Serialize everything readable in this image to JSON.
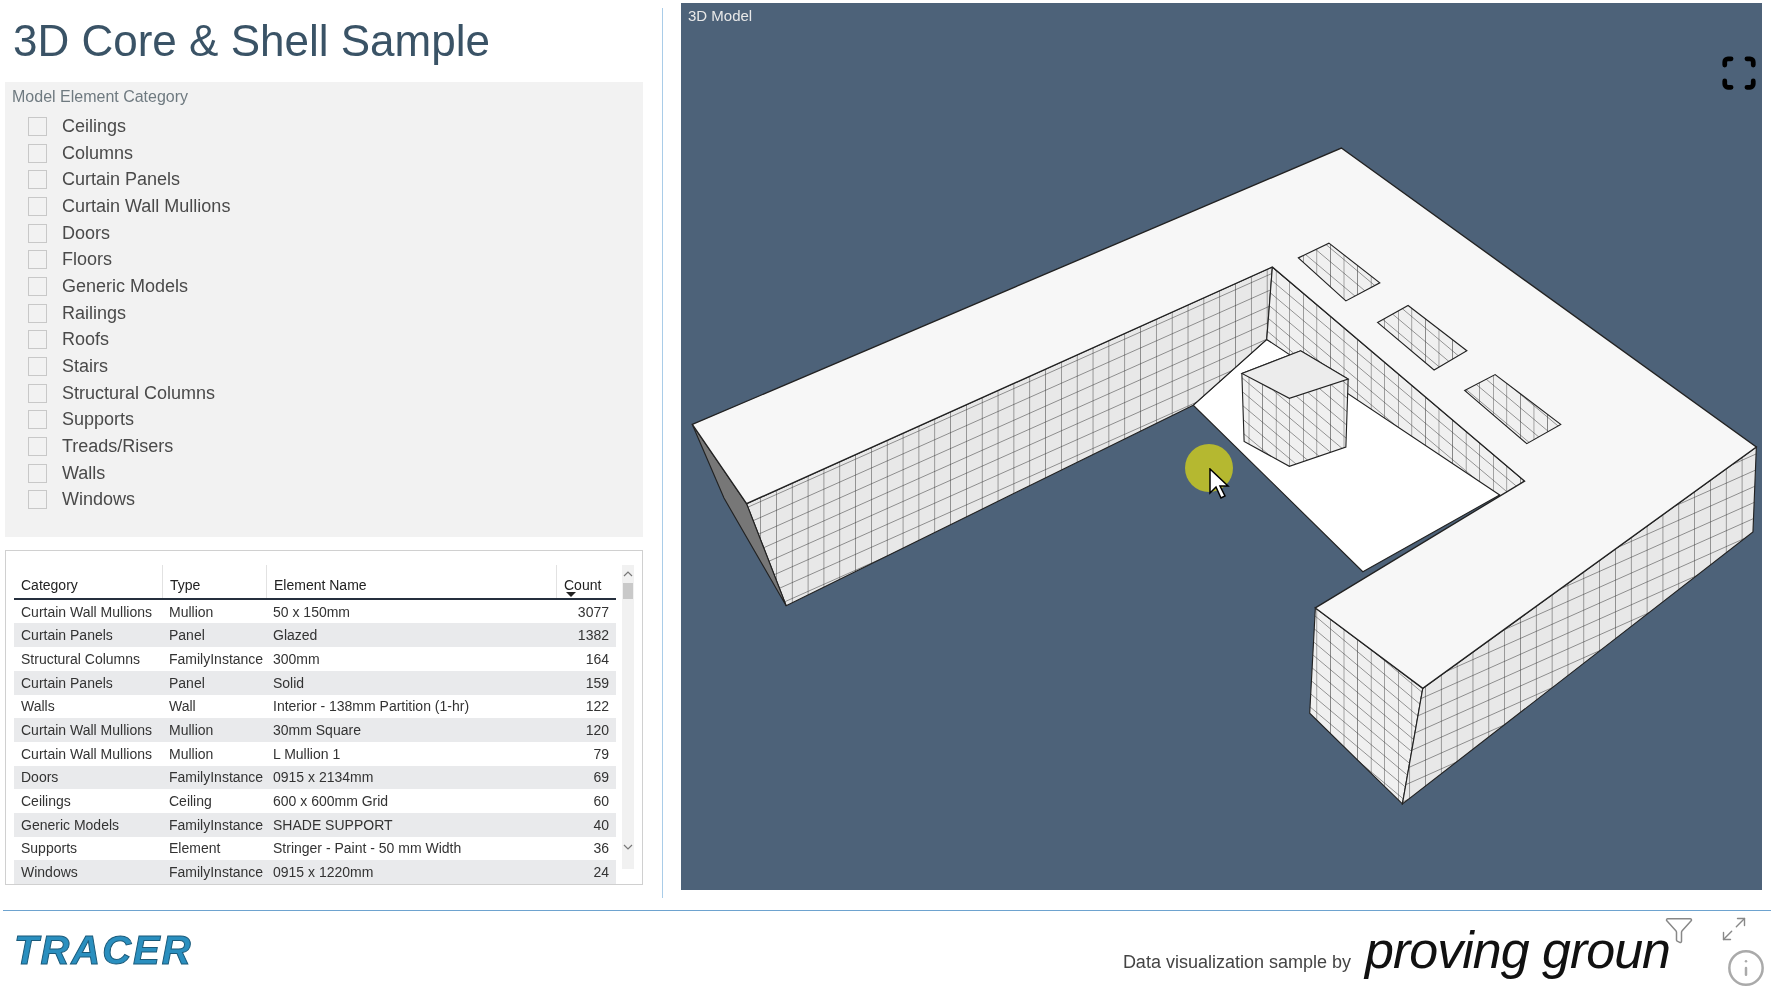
{
  "title": "3D Core & Shell Sample",
  "slicer": {
    "title": "Model Element Category",
    "items": [
      {
        "label": "Ceilings",
        "checked": false
      },
      {
        "label": "Columns",
        "checked": false
      },
      {
        "label": "Curtain Panels",
        "checked": false
      },
      {
        "label": "Curtain Wall Mullions",
        "checked": false
      },
      {
        "label": "Doors",
        "checked": false
      },
      {
        "label": "Floors",
        "checked": false
      },
      {
        "label": "Generic Models",
        "checked": false
      },
      {
        "label": "Railings",
        "checked": false
      },
      {
        "label": "Roofs",
        "checked": false
      },
      {
        "label": "Stairs",
        "checked": false
      },
      {
        "label": "Structural Columns",
        "checked": false
      },
      {
        "label": "Supports",
        "checked": false
      },
      {
        "label": "Treads/Risers",
        "checked": false
      },
      {
        "label": "Walls",
        "checked": false
      },
      {
        "label": "Windows",
        "checked": false
      }
    ]
  },
  "table": {
    "columns": [
      "Category",
      "Type",
      "Element Name",
      "Count"
    ],
    "rows": [
      [
        "Curtain Wall Mullions",
        "Mullion",
        "50 x 150mm",
        "3077"
      ],
      [
        "Curtain Panels",
        "Panel",
        "Glazed",
        "1382"
      ],
      [
        "Structural Columns",
        "FamilyInstance",
        "300mm",
        "164"
      ],
      [
        "Curtain Panels",
        "Panel",
        "Solid",
        "159"
      ],
      [
        "Walls",
        "Wall",
        "Interior - 138mm Partition (1-hr)",
        "122"
      ],
      [
        "Curtain Wall Mullions",
        "Mullion",
        "30mm Square",
        "120"
      ],
      [
        "Curtain Wall Mullions",
        "Mullion",
        "L Mullion 1",
        "79"
      ],
      [
        "Doors",
        "FamilyInstance",
        "0915 x 2134mm",
        "69"
      ],
      [
        "Ceilings",
        "Ceiling",
        "600 x 600mm Grid",
        "60"
      ],
      [
        "Generic Models",
        "FamilyInstance",
        "SHADE SUPPORT",
        "40"
      ],
      [
        "Supports",
        "Element",
        "Stringer - Paint - 50 mm Width",
        "36"
      ],
      [
        "Windows",
        "FamilyInstance",
        "0915 x 1220mm",
        "24"
      ]
    ]
  },
  "viewer": {
    "title": "3D Model"
  },
  "footer": {
    "logo": "TRACER",
    "credit": "Data visualization sample by",
    "brand": "proving groun"
  }
}
